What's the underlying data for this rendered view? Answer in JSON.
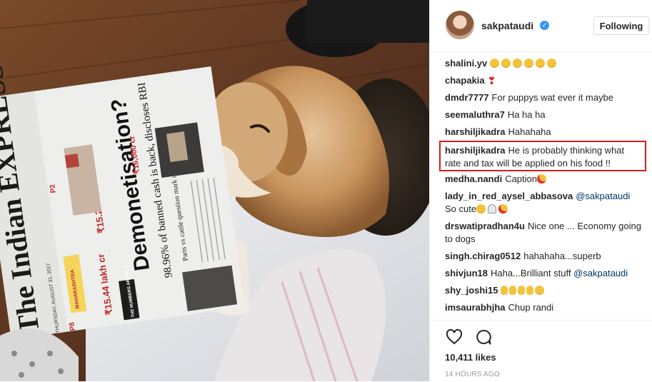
{
  "post": {
    "username": "sakpataudi",
    "follow_label": "Following",
    "likes": "10,411 likes",
    "time": "14 HOURS AGO"
  },
  "photo": {
    "newspaper": {
      "masthead": "The Indian EXPRESS",
      "headline": "Demonetisation?",
      "subhead": "98.96% of banned cash is back, discloses RBI",
      "price1": "₹15.28 lakh cr",
      "price2": "₹15.44 lakh cr",
      "price3": "₹16,000 cr",
      "box": "THE NUMBERS ARE IN",
      "mahakali": "MAHARASHTRA",
      "pp": "P2",
      "pp2": "P8",
      "small": "Parts vs cattle question mark over newborn",
      "date": "THURSDAY, AUGUST 31, 2017"
    }
  },
  "comments": [
    {
      "user": "shalini.yv",
      "text": "",
      "emoji": [
        "tear",
        "smile",
        "tear",
        "smile",
        "tear",
        "smile"
      ]
    },
    {
      "user": "chapakia",
      "text": "",
      "emoji": [
        "heart"
      ]
    },
    {
      "user": "dmdr7777",
      "text": "For puppys wat ever it maybe"
    },
    {
      "user": "seemaluthra7",
      "text": "Ha ha ha"
    },
    {
      "user": "harshiljikadra",
      "text": "Hahahaha"
    },
    {
      "user": "harshiljikadra",
      "text": "He is probably thinking what rate and tax will be applied on his food !!"
    },
    {
      "user": "medha.nandi",
      "text": "Caption",
      "emoji": [
        "heart-eyes"
      ]
    },
    {
      "user": "lady_in_red_aysel_abbasova",
      "text": "",
      "mention": "@sakpataudi",
      "text2": "So cute",
      "emoji": [
        "tear",
        "ghost",
        "heart-eyes"
      ]
    },
    {
      "user": "drswatipradhan4u",
      "text": "Nice one ... Economy going to dogs"
    },
    {
      "user": "singh.chirag0512",
      "text": "hahahaha...superb"
    },
    {
      "user": "shivjun18",
      "text": "Haha...Brilliant stuff",
      "mention": "@sakpataudi"
    },
    {
      "user": "shy_joshi15",
      "text": "",
      "emoji": [
        "hand",
        "hand",
        "hand",
        "hand",
        "smile"
      ]
    },
    {
      "user": "imsaurabhjha",
      "text": "Chup randi"
    }
  ]
}
